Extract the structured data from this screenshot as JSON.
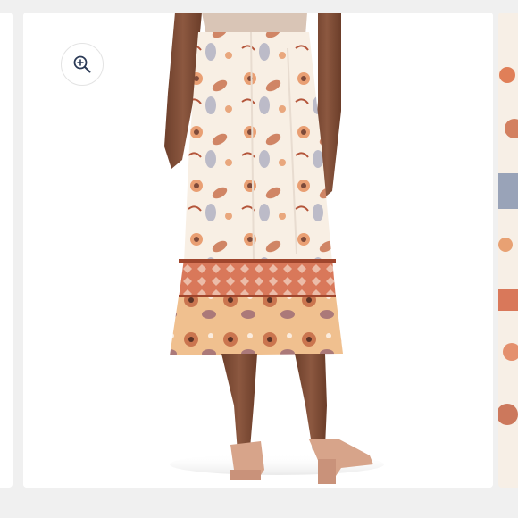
{
  "gallery": {
    "zoom_button": {
      "icon": "zoom-in-icon"
    },
    "main_image": {
      "alt": ""
    },
    "colors": {
      "skirt_base": "#f8efe4",
      "rust_band": "#d9785a",
      "peach_hem": "#f0c08f",
      "skin": "#7a4a33",
      "sandal": "#d7a48a"
    }
  }
}
